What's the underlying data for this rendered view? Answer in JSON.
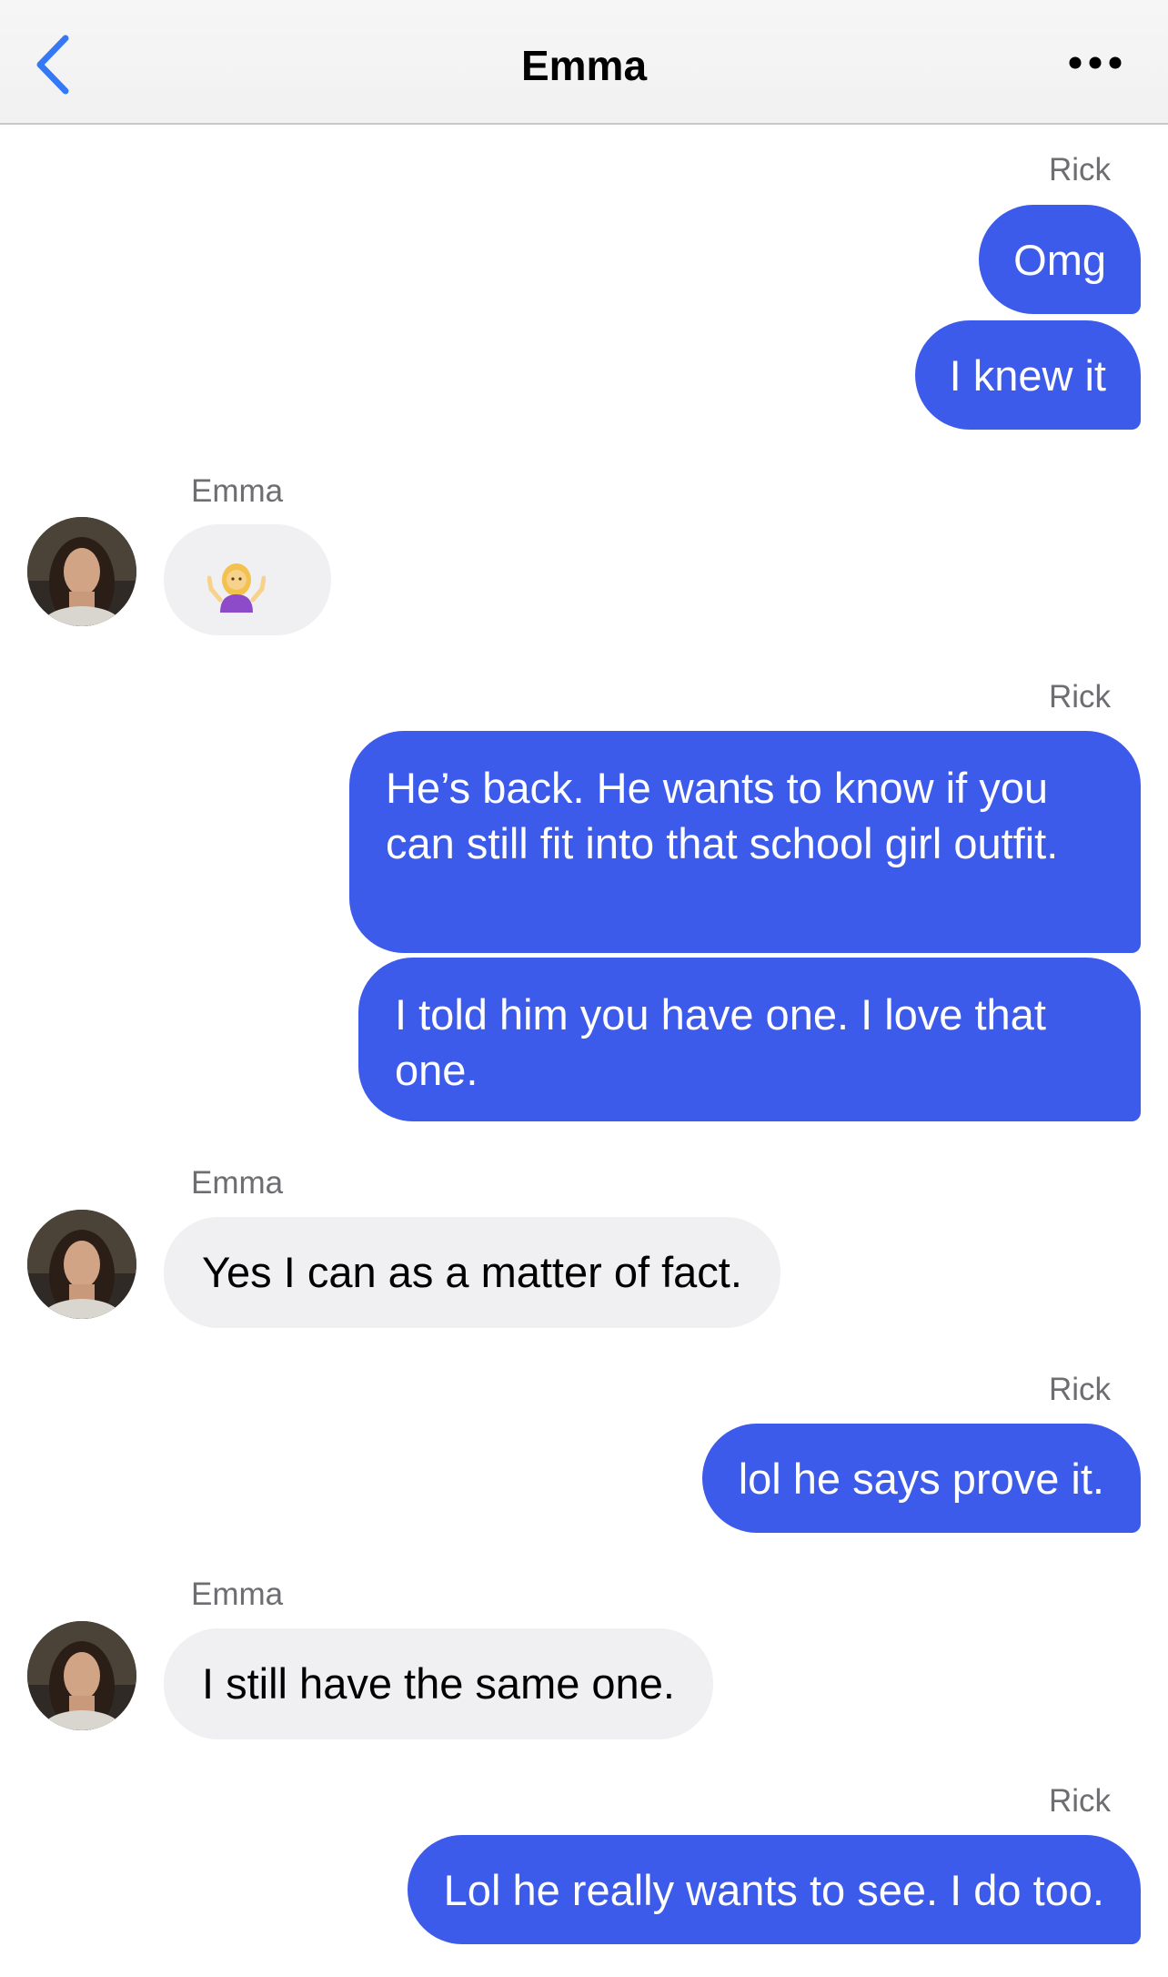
{
  "header": {
    "title": "Emma",
    "back_icon": "chevron-left-icon",
    "more_icon": "ellipsis-icon",
    "accent_color": "#3478f6"
  },
  "colors": {
    "outgoing_bubble": "#3d5bea",
    "incoming_bubble": "#f0f0f3"
  },
  "messages": [
    {
      "sender": "Rick",
      "direction": "outgoing",
      "texts": [
        "Omg",
        "I knew it"
      ]
    },
    {
      "sender": "Emma",
      "direction": "incoming",
      "emoji": "person-shrugging-emoji"
    },
    {
      "sender": "Rick",
      "direction": "outgoing",
      "texts": [
        "He’s back. He wants to know if you can still fit into that school girl outfit.",
        "I told him you have one. I love that one."
      ]
    },
    {
      "sender": "Emma",
      "direction": "incoming",
      "texts": [
        "Yes I can as a matter of fact."
      ]
    },
    {
      "sender": "Rick",
      "direction": "outgoing",
      "texts": [
        "lol he says prove it."
      ]
    },
    {
      "sender": "Emma",
      "direction": "incoming",
      "texts": [
        "I still have the same one."
      ]
    },
    {
      "sender": "Rick",
      "direction": "outgoing",
      "texts": [
        "Lol he really wants to see. I do too."
      ]
    }
  ]
}
